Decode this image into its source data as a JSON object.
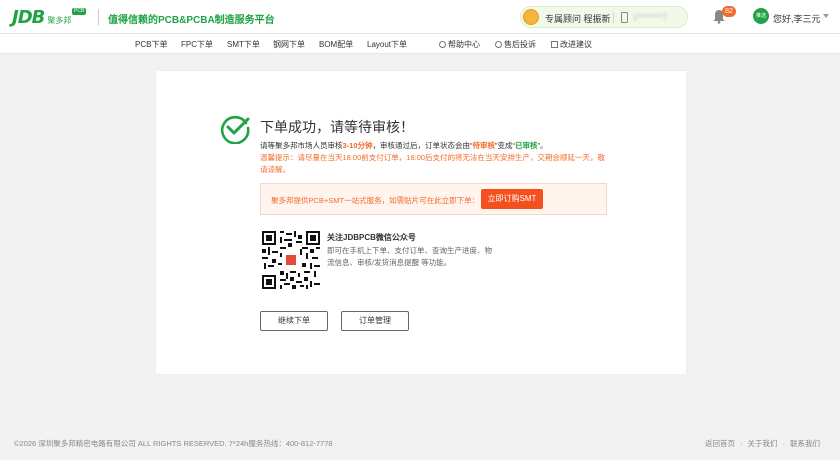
{
  "header": {
    "logo_text": "JDB",
    "logo_sub": "聚多邦",
    "logo_badge": "PCB",
    "slogan": "值得信赖的PCB&PCBA制造服务平台",
    "advisor_label": "专属顾问 程振新",
    "advisor_phone": "1********7",
    "notification_count": "82",
    "avatar_text": "推选",
    "user_greeting": "您好,李三元"
  },
  "nav": {
    "items": [
      "PCB下单",
      "FPC下单",
      "SMT下单",
      "钢网下单",
      "BOM配单",
      "Layout下单"
    ],
    "help": "帮助中心",
    "complaint": "售后投诉",
    "suggestion": "改进建议"
  },
  "main": {
    "title": "下单成功，请等待审核！",
    "desc_prefix": "请等聚多邦市场人员审核",
    "desc_time": "3-10分钟",
    "desc_middle": "，审核通过后，订单状态会由“",
    "desc_status_from": "待审核",
    "desc_change": "”变成“",
    "desc_status_to": "已审核",
    "desc_suffix": "”。",
    "tip": "温馨提示：请尽量在当天18:00前支付订单，18:00后支付的将无法在当天安排生产，交期会顺延一天，敬请谅解。",
    "promo_text": "聚多邦提供PCB+SMT一站式服务，如需贴片可在此立即下单：",
    "promo_button": "立即订购SMT",
    "wechat_title": "关注JDBPCB微信公众号",
    "wechat_desc": "即可在手机上下单、支付订单、查询生产进度、物流信息、审核/发货消息提醒 等功能。",
    "continue_button": "继续下单",
    "manage_button": "订单管理"
  },
  "footer": {
    "copyright": "©2026 深圳聚多邦精密电路有限公司 ALL RIGHTS RESERVED. 7*24h服务热线：400-812-7778",
    "links": [
      "返回首页",
      "关于我们",
      "联系我们"
    ]
  },
  "colors": {
    "brand_green": "#21a345",
    "accent_orange": "#f46c2b",
    "button_orange": "#f4501e"
  }
}
